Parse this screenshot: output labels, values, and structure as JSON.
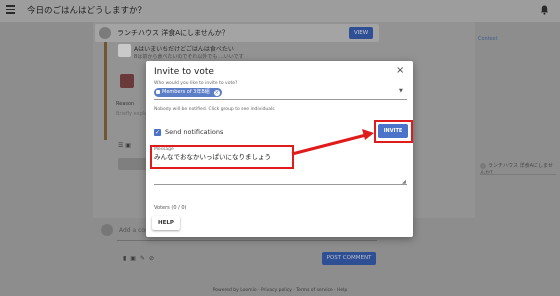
{
  "appbar": {
    "title": "今日のごはんはどうしますか？"
  },
  "proposal": {
    "text": "ランチハウス 洋食Aにしませんか？",
    "view_label": "VIEW"
  },
  "poll": {
    "option1_title": "Aはいまいちだけどごはんは食べたい",
    "option1_subtitle": "Bは前から食べたいのでそれ以外でも ...いいです",
    "reason_label": "Reason",
    "reason_hint": "Briefly explain..."
  },
  "right": {
    "context_label": "Context",
    "vote_text": "ランチハウス 洋食Aにしませんか？"
  },
  "comment": {
    "placeholder": "Add a comment",
    "post_label": "POST COMMENT"
  },
  "footer": {
    "text": "Powered by Loomio · Privacy policy · Terms of service · Help"
  },
  "dialog": {
    "title": "Invite to vote",
    "question": "Who would you like to invite to vote?",
    "chip_label": "Members of 3年B組",
    "nobody_notice": "Nobody will be notified. Click group to see individuals",
    "send_notifications_label": "Send notifications",
    "send_notifications_checked": true,
    "invite_label": "INVITE",
    "message_label": "Message",
    "message_text": "みんなでおなかいっぱいになりましょう",
    "voters_text": "Voters (0 / 0)",
    "help_label": "HELP"
  },
  "colors": {
    "accent": "#4a73c9",
    "annotation": "#e01b1b"
  }
}
